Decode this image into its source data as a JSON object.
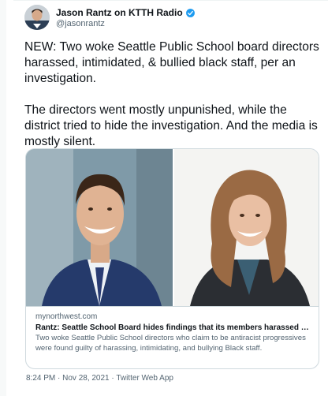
{
  "author": {
    "display_name": "Jason Rantz on KTTH Radio",
    "handle": "@jasonrantz",
    "verified": true
  },
  "tweet": {
    "text": "NEW: Two woke Seattle Public School board directors harassed, intimidated, & bullied black staff, per an investigation.\n\nThe directors went mostly unpunished, while the district tried to hide the investigation. And the media is mostly silent."
  },
  "card": {
    "domain": "mynorthwest.com",
    "title": "Rantz: Seattle School Board hides findings that its members harassed Black st...",
    "description": "Two woke Seattle Public School directors who claim to be antiracist progressives were found guilty of harassing, intimidating, and bullying Black staff."
  },
  "meta": {
    "timestamp": "8:24 PM · Nov 28, 2021 · Twitter Web App"
  },
  "colors": {
    "verified_badge": "#1d9bf0",
    "secondary_text": "#536471",
    "border": "#cfd9de"
  }
}
